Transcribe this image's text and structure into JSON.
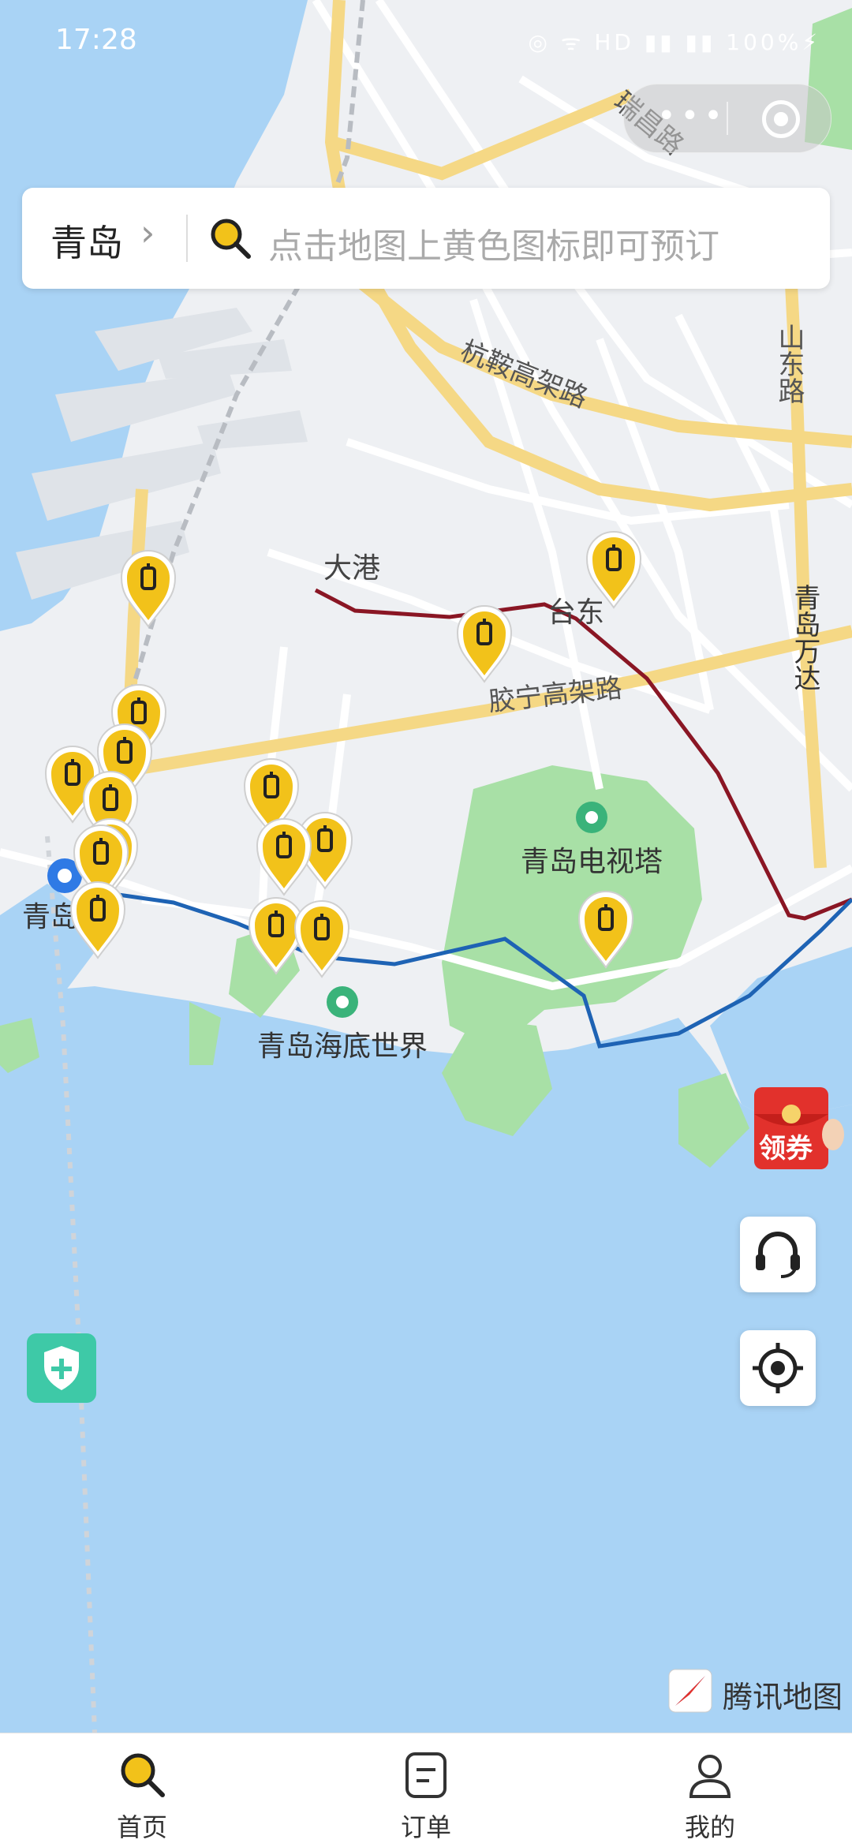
{
  "status_bar": {
    "time": "17:28",
    "icons": "◎ ᯤ HD ▮▮ ▮▮ 100%⚡"
  },
  "capsule": {
    "more": "•••",
    "close": "◉"
  },
  "search": {
    "city": "青岛",
    "placeholder": "点击地图上黄色图标即可预订"
  },
  "map": {
    "roads": [
      "瑞昌路",
      "杭鞍高架路",
      "山东路",
      "胶宁高架路"
    ],
    "places": [
      "大港",
      "台东",
      "青岛电视塔",
      "青岛海底世界",
      "青岛站",
      "青岛万达"
    ],
    "pin_count": 16,
    "brand_yellow": "#f2c21a",
    "water_color": "#a9d3f5",
    "land_color": "#eef0f3"
  },
  "floating": {
    "redpacket_label": "领券"
  },
  "attribution": {
    "label": "腾讯地图"
  },
  "tabs": [
    {
      "label": "首页",
      "icon": "search-icon"
    },
    {
      "label": "订单",
      "icon": "order-icon"
    },
    {
      "label": "我的",
      "icon": "user-icon"
    }
  ]
}
